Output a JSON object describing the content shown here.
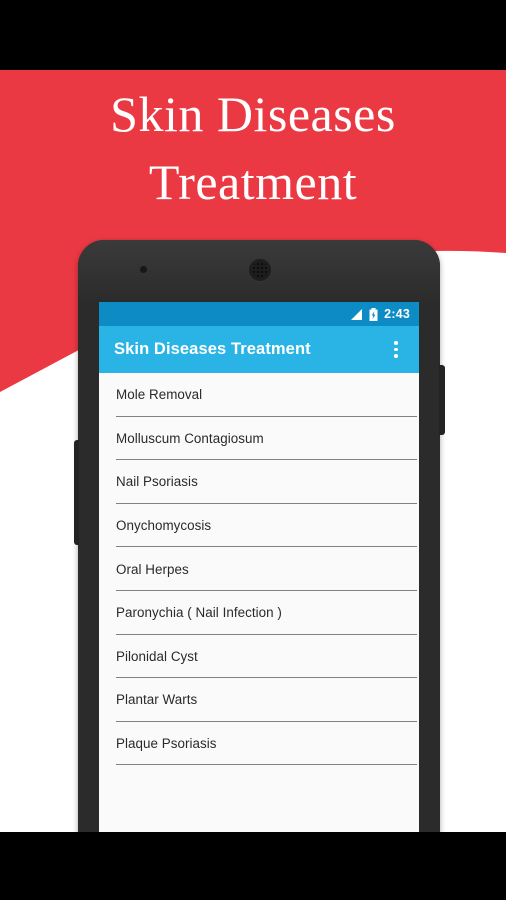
{
  "promo": {
    "headline_line1": "Skin Diseases",
    "headline_line2": "Treatment",
    "banner_color": "#ea3943",
    "background_color": "#ffffff"
  },
  "device": {
    "frame_color": "#2b2b2b",
    "front_camera": "front-camera-icon",
    "earpiece": "earpiece-speaker-icon",
    "volume_button": "volume-button",
    "power_button": "power-button"
  },
  "statusbar": {
    "time": "2:43",
    "signal_icon": "signal-icon",
    "battery_icon": "battery-charging-icon",
    "background_color": "#0c8bc4"
  },
  "appbar": {
    "title": "Skin Diseases Treatment",
    "overflow_icon": "overflow-menu-icon",
    "background_color": "#29b4e5"
  },
  "list": {
    "items": [
      {
        "label": "Mole Removal"
      },
      {
        "label": "Molluscum Contagiosum"
      },
      {
        "label": "Nail Psoriasis"
      },
      {
        "label": "Onychomycosis"
      },
      {
        "label": "Oral Herpes"
      },
      {
        "label": "Paronychia ( Nail Infection )"
      },
      {
        "label": "Pilonidal Cyst"
      },
      {
        "label": "Plantar Warts"
      },
      {
        "label": "Plaque Psoriasis"
      }
    ]
  }
}
